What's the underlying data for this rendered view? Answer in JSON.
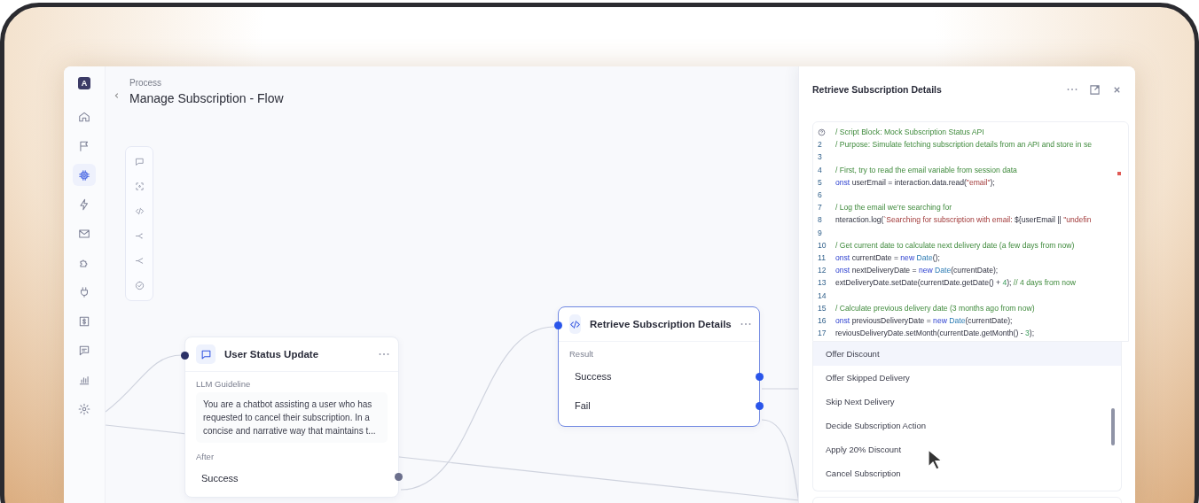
{
  "sidebar": {
    "logo": "A",
    "items": [
      {
        "selected": false
      },
      {
        "selected": false
      },
      {
        "selected": true
      },
      {
        "selected": false
      },
      {
        "selected": false
      },
      {
        "selected": false
      },
      {
        "selected": false
      },
      {
        "selected": false
      },
      {
        "selected": false
      },
      {
        "selected": false
      },
      {
        "selected": false
      }
    ]
  },
  "header": {
    "breadcrumb": "Process",
    "title": "Manage Subscription - Flow"
  },
  "nodes": [
    {
      "kind": "llm",
      "title": "User Status Update",
      "selected": false,
      "section_label": "LLM Guideline",
      "prompt": "You are a chatbot assisting a user who has requested to cancel their subscription. In a concise and narrative way that maintains t...",
      "after_label": "After",
      "outputs": [
        "Success"
      ]
    },
    {
      "kind": "script",
      "title": "Retrieve Subscription Details",
      "selected": true,
      "section_label": "Result",
      "outputs": [
        "Success",
        "Fail"
      ]
    }
  ],
  "panel": {
    "title": "Retrieve Subscription Details",
    "code": [
      {
        "tokens": [
          {
            "kind": "comment",
            "text": "/ Script Block: Mock Subscription Status API"
          }
        ]
      },
      {
        "number": "2",
        "tokens": [
          {
            "kind": "comment",
            "text": "/ Purpose: Simulate fetching subscription details from an API and store in se"
          }
        ]
      },
      {
        "number": "3"
      },
      {
        "number": "4",
        "tokens": [
          {
            "kind": "comment",
            "text": "/ First, try to read the email variable from session data"
          }
        ]
      },
      {
        "number": "5",
        "tokens": [
          {
            "kind": "keyword",
            "text": "onst"
          },
          {
            "kind": "plain",
            "text": " userEmail = interaction.data.read("
          },
          {
            "kind": "string",
            "text": "\"email\""
          },
          {
            "kind": "plain",
            "text": ");"
          }
        ]
      },
      {
        "number": "6"
      },
      {
        "number": "7",
        "tokens": [
          {
            "kind": "comment",
            "text": "/ Log the email we're searching for"
          }
        ]
      },
      {
        "number": "8",
        "tokens": [
          {
            "kind": "plain",
            "text": "nteraction.log("
          },
          {
            "kind": "string",
            "text": "`Searching for subscription with email: "
          },
          {
            "kind": "plain",
            "text": "${userEmail || "
          },
          {
            "kind": "string",
            "text": "\"undefin"
          }
        ]
      },
      {
        "number": "9"
      },
      {
        "number": "10",
        "tokens": [
          {
            "kind": "comment",
            "text": "/ Get current date to calculate next delivery date (a few days from now)"
          }
        ]
      },
      {
        "number": "11",
        "tokens": [
          {
            "kind": "keyword",
            "text": "onst"
          },
          {
            "kind": "plain",
            "text": " currentDate = "
          },
          {
            "kind": "keyword",
            "text": "new"
          },
          {
            "kind": "type",
            "text": "Date"
          },
          {
            "kind": "plain",
            "text": "();"
          }
        ]
      },
      {
        "number": "12",
        "tokens": [
          {
            "kind": "keyword",
            "text": "onst"
          },
          {
            "kind": "plain",
            "text": " nextDeliveryDate = "
          },
          {
            "kind": "keyword",
            "text": "new"
          },
          {
            "kind": "type",
            "text": "Date"
          },
          {
            "kind": "plain",
            "text": "(currentDate);"
          }
        ]
      },
      {
        "number": "13",
        "tokens": [
          {
            "kind": "plain",
            "text": "extDeliveryDate.setDate(currentDate.getDate() + "
          },
          {
            "kind": "number",
            "text": "4"
          },
          {
            "kind": "plain",
            "text": "); "
          },
          {
            "kind": "comment",
            "text": "// 4 days from now"
          }
        ]
      },
      {
        "number": "14"
      },
      {
        "number": "15",
        "tokens": [
          {
            "kind": "comment",
            "text": "/ Calculate previous delivery date (3 months ago from now)"
          }
        ]
      },
      {
        "number": "16",
        "tokens": [
          {
            "kind": "keyword",
            "text": "onst"
          },
          {
            "kind": "plain",
            "text": " previousDeliveryDate = "
          },
          {
            "kind": "keyword",
            "text": "new"
          },
          {
            "kind": "type",
            "text": "Date"
          },
          {
            "kind": "plain",
            "text": "(currentDate);"
          }
        ]
      },
      {
        "number": "17",
        "tokens": [
          {
            "kind": "plain",
            "text": "reviousDeliveryDate.setMonth(currentDate.getMonth() - "
          },
          {
            "kind": "number",
            "text": "3"
          },
          {
            "kind": "plain",
            "text": ");"
          }
        ]
      }
    ],
    "options": [
      {
        "label": "Offer Discount",
        "selected": true
      },
      {
        "label": "Offer Skipped Delivery",
        "selected": false
      },
      {
        "label": "Skip Next Delivery",
        "selected": false
      },
      {
        "label": "Decide Subscription Action",
        "selected": false
      },
      {
        "label": "Apply 20% Discount",
        "selected": false
      },
      {
        "label": "Cancel Subscription",
        "selected": false
      }
    ]
  }
}
